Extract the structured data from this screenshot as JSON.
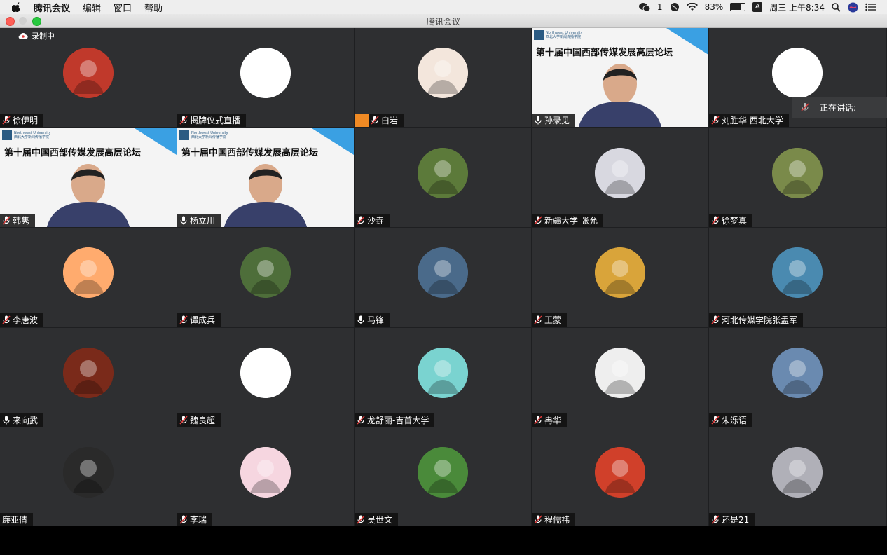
{
  "menubar": {
    "app_name": "腾讯会议",
    "menus": [
      "编辑",
      "窗口",
      "帮助"
    ],
    "wechat_count": "1",
    "battery": "83%",
    "input_method": "A",
    "datetime": "周三 上午8:34"
  },
  "window": {
    "title": "腾讯会议"
  },
  "recording": {
    "label": "录制中"
  },
  "speaking": {
    "label": "正在讲话:"
  },
  "participants": [
    {
      "name": "徐伊明",
      "mic": "muted",
      "avatar": "cartoon-animal",
      "color": "#c0392b"
    },
    {
      "name": "揭牌仪式直播",
      "mic": "muted",
      "avatar": "logo-cube",
      "color": "#ffffff"
    },
    {
      "name": "白岩",
      "mic": "muted",
      "avatar": "illustrated-woman",
      "color": "#f3e6dc",
      "badge": "orange-person"
    },
    {
      "name": "孙录见",
      "mic": "on",
      "video": true,
      "banner": "第十届中国西部传媒发展高层论坛"
    },
    {
      "name": "刘胜华 西北大学",
      "mic": "muted",
      "avatar": "blank-white",
      "color": "#ffffff"
    },
    {
      "name": "韩隽",
      "mic": "muted",
      "video": true,
      "banner": "第十届中国西部传媒发展高层论坛"
    },
    {
      "name": "杨立川",
      "mic": "on",
      "video": true,
      "banner": "第十届中国西部传媒发展高层论坛"
    },
    {
      "name": "沙垚",
      "mic": "muted",
      "avatar": "man-outdoor",
      "color": "#5c7a3a"
    },
    {
      "name": "新疆大学  张允",
      "mic": "muted",
      "avatar": "flower-vase",
      "color": "#d8d8e0"
    },
    {
      "name": "徐梦真",
      "mic": "muted",
      "avatar": "sunflower-girl",
      "color": "#7a8a4a"
    },
    {
      "name": "李唐波",
      "mic": "muted",
      "avatar": "cartoon-dog",
      "color": "#ffab6e"
    },
    {
      "name": "谭成兵",
      "mic": "muted",
      "avatar": "landscape-field",
      "color": "#4e6e3a"
    },
    {
      "name": "马锋",
      "mic": "on",
      "avatar": "man-field",
      "color": "#4a6a8a"
    },
    {
      "name": "王蒙",
      "mic": "muted",
      "avatar": "cafe-painting",
      "color": "#d9a43a"
    },
    {
      "name": "河北传媒学院张孟军",
      "mic": "muted",
      "avatar": "beach",
      "color": "#4a8ab0"
    },
    {
      "name": "来向武",
      "mic": "on",
      "avatar": "man-podium",
      "color": "#7a2a1a"
    },
    {
      "name": "魏良超",
      "mic": "muted",
      "avatar": "line-drawing",
      "color": "#ffffff"
    },
    {
      "name": "龙舒丽-吉首大学",
      "mic": "muted",
      "avatar": "cartoon-boy",
      "color": "#7ad3d0"
    },
    {
      "name": "冉华",
      "mic": "muted",
      "avatar": "sketch-woman",
      "color": "#eeeeee"
    },
    {
      "name": "朱泺语",
      "mic": "muted",
      "avatar": "mountain-town",
      "color": "#6a8ab0"
    },
    {
      "name": "廉亚倩",
      "mic": "none",
      "avatar": "anime-girl",
      "color": "#2a2a2a"
    },
    {
      "name": "李瑞",
      "mic": "muted",
      "avatar": "cartoon-girl",
      "color": "#f6d6e0"
    },
    {
      "name": "吴世文",
      "mic": "muted",
      "avatar": "terraces",
      "color": "#4a8a3a"
    },
    {
      "name": "程儒祎",
      "mic": "muted",
      "avatar": "cartoon-tiger",
      "color": "#d0402a"
    },
    {
      "name": "还是21",
      "mic": "muted",
      "avatar": "blue-earphones",
      "color": "#b0b0b8"
    }
  ]
}
